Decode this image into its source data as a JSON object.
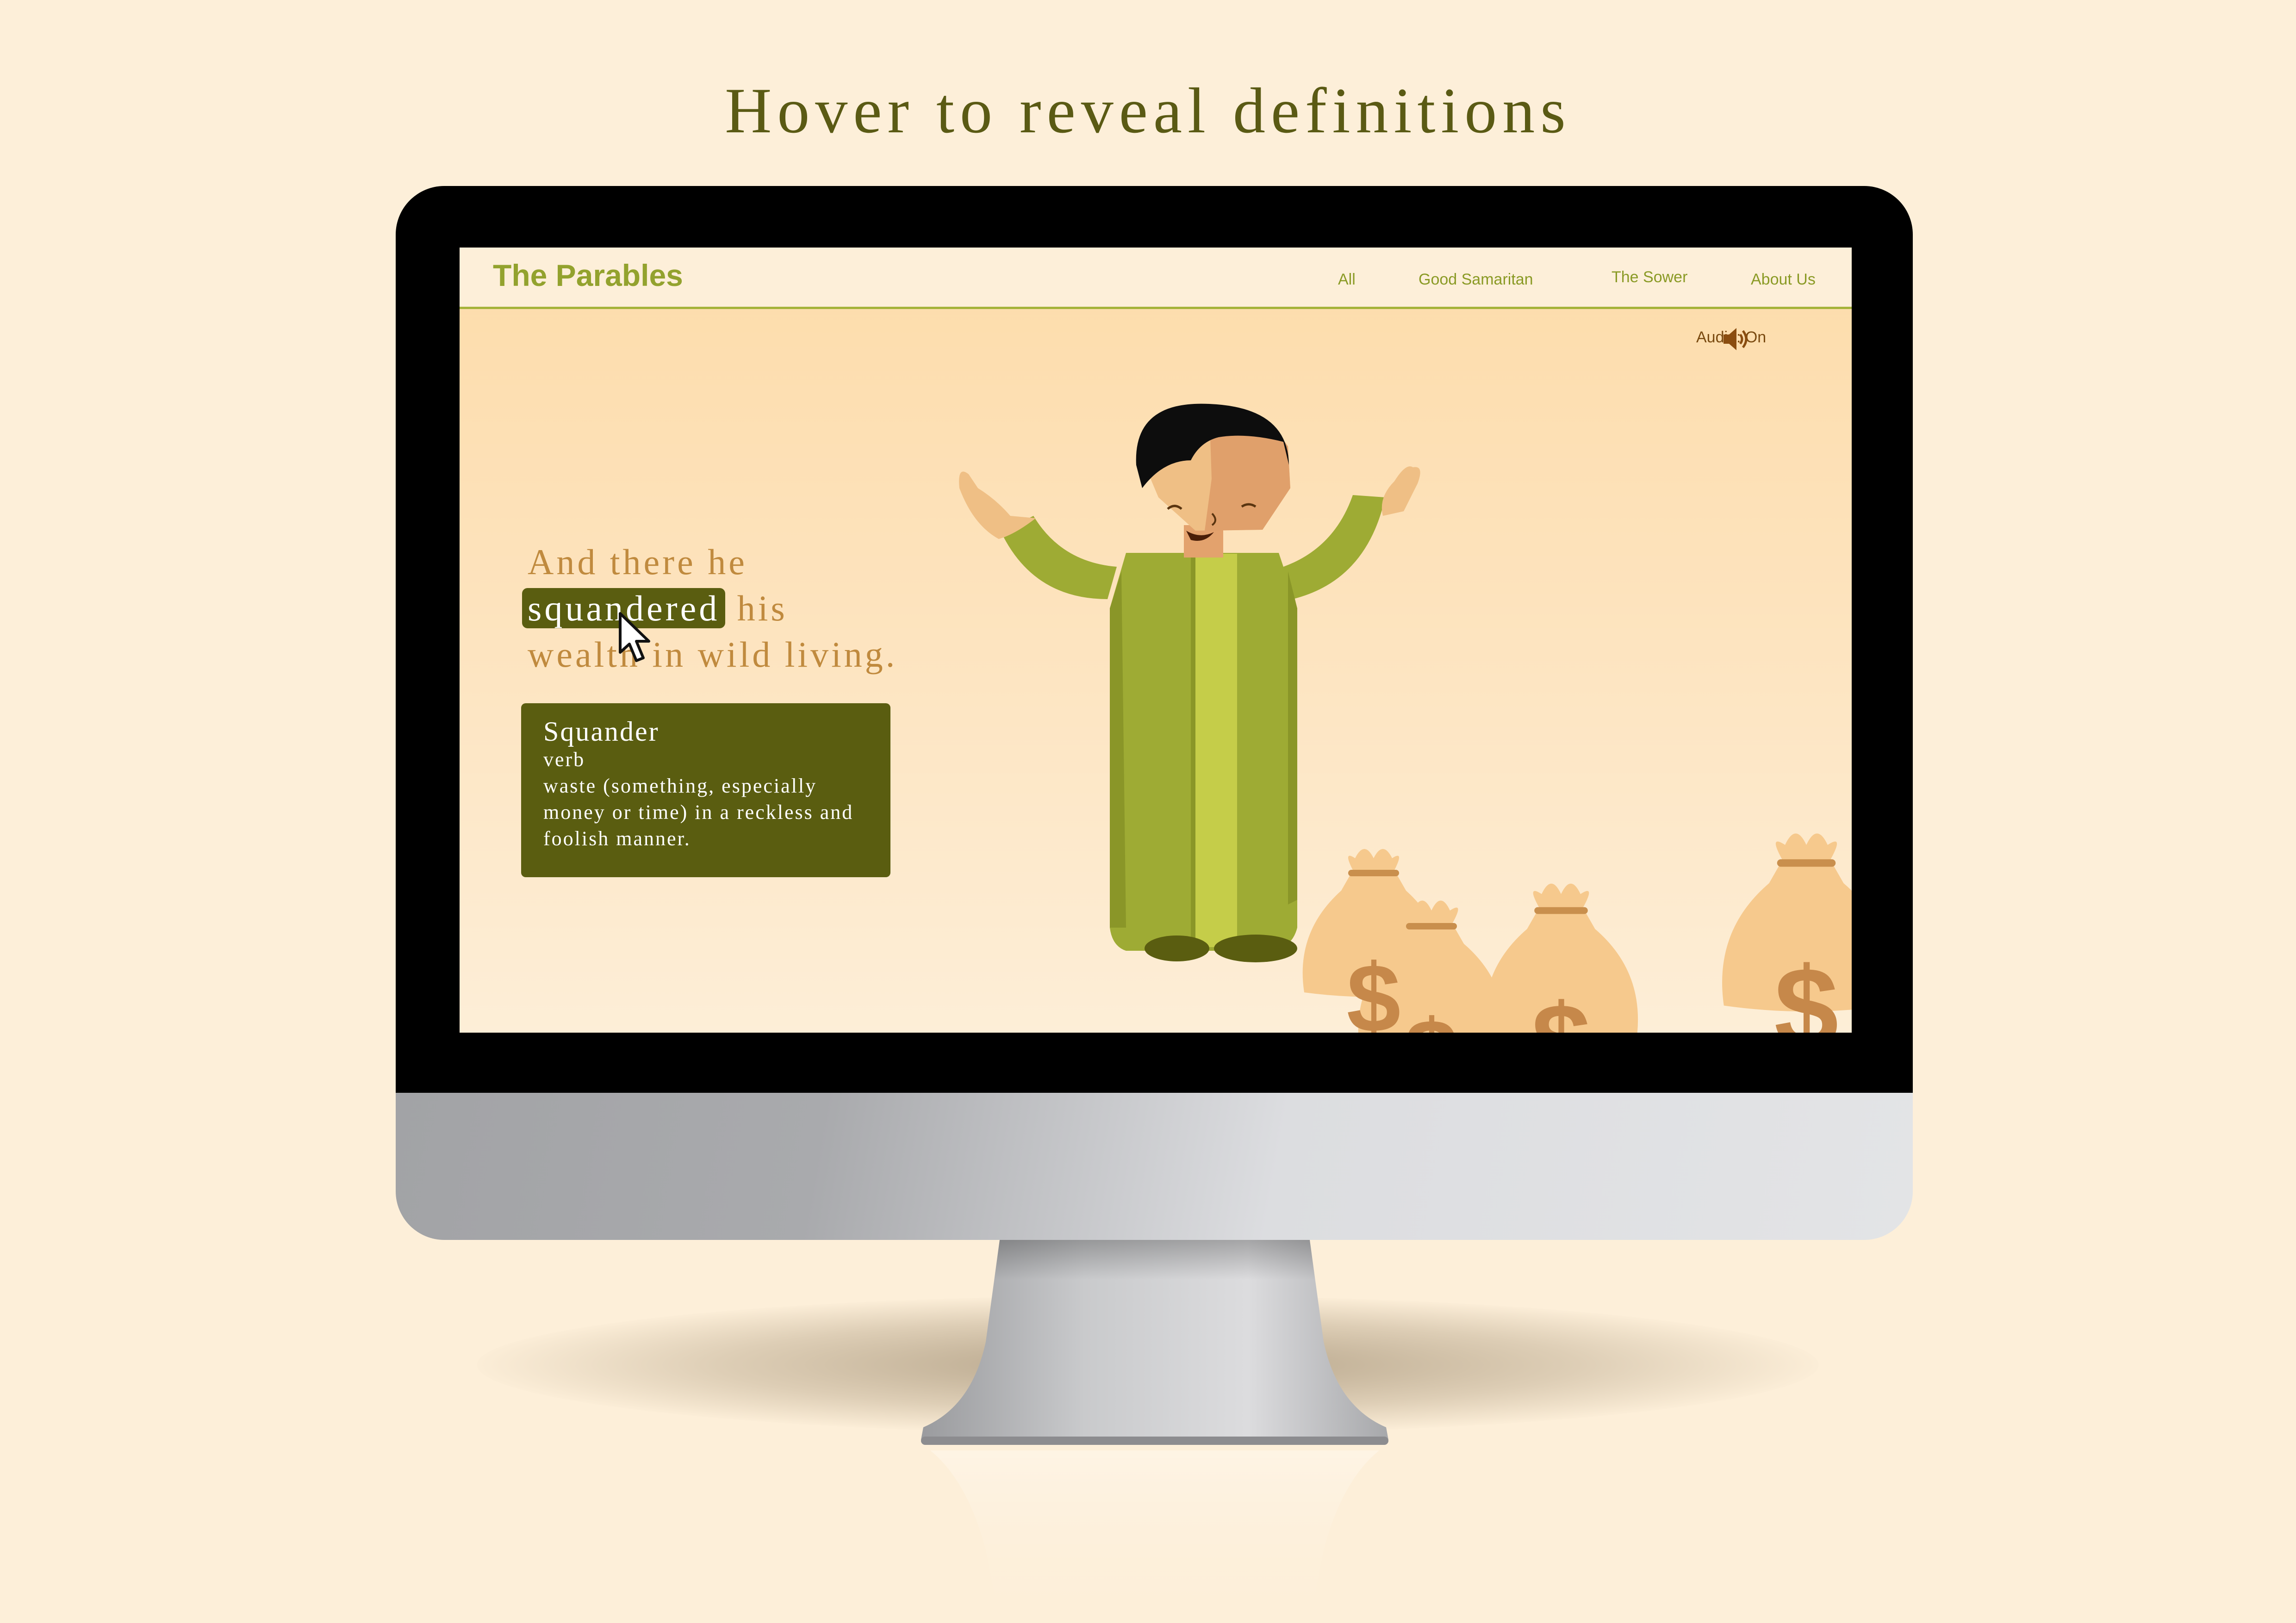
{
  "headline": "Hover to reveal definitions",
  "site": {
    "brand": "The Parables",
    "nav": [
      "All",
      "Good Samaritan",
      "The Sower",
      "About Us"
    ],
    "audio_label": "Audio: On"
  },
  "verse": {
    "line1": "And there he",
    "highlight": "squandered",
    "line2_rest": "his",
    "line3": "wealth in wild living."
  },
  "definition": {
    "word": "Squander",
    "part_of_speech": "verb",
    "text": "waste (something, especially money or time) in a reckless and foolish manner."
  },
  "icons": [
    "speaker-icon",
    "cursor-icon",
    "dollar-sign-icon"
  ],
  "colors": {
    "background": "#fdefd9",
    "brand_green": "#93a22e",
    "highlight": "#5a5d10",
    "verse_text": "#c08a3e",
    "robe": "#9eab34"
  }
}
